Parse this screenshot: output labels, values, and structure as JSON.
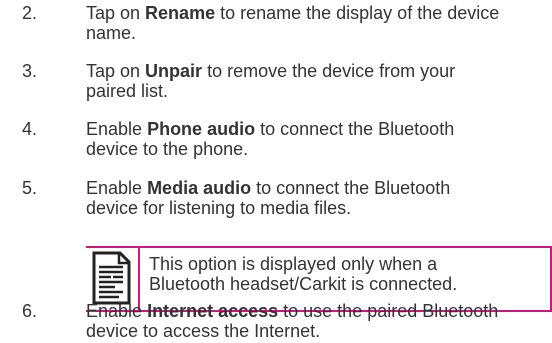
{
  "steps": [
    {
      "number": "2.",
      "pre": "Tap on ",
      "bold": "Rename",
      "line1_rest": " to rename the display of the device",
      "line2": "name."
    },
    {
      "number": "3.",
      "pre": "Tap on ",
      "bold": "Unpair",
      "line1_rest": " to remove the device from your",
      "line2": "paired list."
    },
    {
      "number": "4.",
      "pre": "Enable ",
      "bold": "Phone audio",
      "line1_rest": " to connect the Bluetooth",
      "line2": "device to the phone."
    },
    {
      "number": "5.",
      "pre": "Enable ",
      "bold": "Media audio",
      "line1_rest": " to connect the Bluetooth",
      "line2": "device for listening to media files."
    },
    {
      "number": "6.",
      "pre": "Enable ",
      "bold": "Internet access",
      "line1_rest": " to use the paired Bluetooth",
      "line2": "device to access the Internet."
    }
  ],
  "note": {
    "icon": "note-document-icon",
    "line1": "This option is displayed only when a",
    "line2": "Bluetooth headset/Carkit is connected."
  },
  "colors": {
    "text": "#333333",
    "note_border": "#d0157d",
    "icon": "#222222"
  }
}
